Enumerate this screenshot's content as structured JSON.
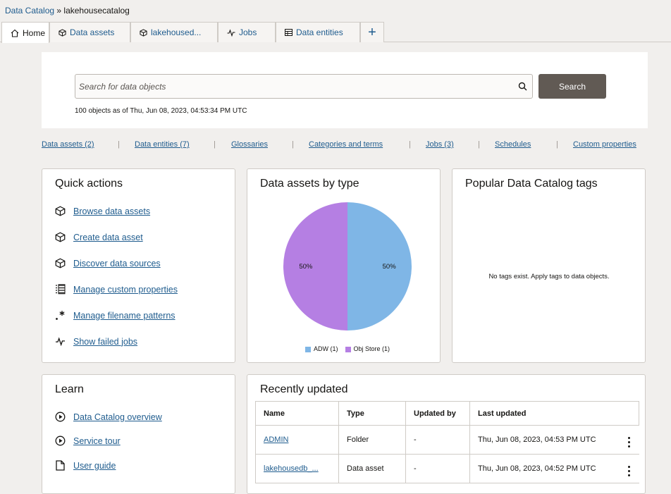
{
  "breadcrumb": {
    "root": "Data Catalog",
    "separator": "»",
    "current": "lakehousecatalog"
  },
  "tabs": [
    {
      "label": "Home",
      "icon": "home-icon"
    },
    {
      "label": "Data assets",
      "icon": "cube-icon"
    },
    {
      "label": "lakehoused...",
      "icon": "cube-icon"
    },
    {
      "label": "Jobs",
      "icon": "pulse-icon"
    },
    {
      "label": "Data entities",
      "icon": "table-icon"
    }
  ],
  "add_tab_label": "+",
  "search": {
    "placeholder": "Search for data objects",
    "button": "Search",
    "status": "100 objects as of Thu, Jun 08, 2023, 04:53:34 PM UTC"
  },
  "quicklinks": [
    "Data assets (2)",
    "Data entities (7)",
    "Glossaries",
    "Categories and terms",
    "Jobs (3)",
    "Schedules",
    "Custom properties"
  ],
  "quick_actions": {
    "title": "Quick actions",
    "items": [
      {
        "label": "Browse data assets",
        "icon": "cube-icon"
      },
      {
        "label": "Create data asset",
        "icon": "cube-icon"
      },
      {
        "label": "Discover data sources",
        "icon": "cube-icon"
      },
      {
        "label": "Manage custom properties",
        "icon": "list-icon"
      },
      {
        "label": "Manage filename patterns",
        "icon": "asterisk-icon"
      },
      {
        "label": "Show failed jobs",
        "icon": "pulse-icon"
      }
    ]
  },
  "assets_by_type": {
    "title": "Data assets by type",
    "colors": {
      "ADW": "#7fb6e6",
      "Obj Store": "#b57fe3"
    }
  },
  "chart_data": {
    "type": "pie",
    "title": "Data assets by type",
    "categories": [
      "ADW (1)",
      "Obj Store (1)"
    ],
    "values": [
      1,
      1
    ],
    "labels": [
      "50%",
      "50%"
    ],
    "legend": "bottom"
  },
  "tags": {
    "title": "Popular Data Catalog tags",
    "empty": "No tags exist. Apply tags to data objects."
  },
  "learn": {
    "title": "Learn",
    "items": [
      {
        "label": "Data Catalog overview",
        "icon": "play-circle-icon"
      },
      {
        "label": "Service tour",
        "icon": "play-circle-icon"
      },
      {
        "label": "User guide",
        "icon": "document-icon"
      }
    ]
  },
  "recent": {
    "title": "Recently updated",
    "columns": [
      "Name",
      "Type",
      "Updated by",
      "Last updated"
    ],
    "rows": [
      {
        "name": "ADMIN",
        "type": "Folder",
        "updated_by": "-",
        "last_updated": "Thu, Jun 08, 2023, 04:53 PM UTC"
      },
      {
        "name": "lakehousedb_...",
        "type": "Data asset",
        "updated_by": "-",
        "last_updated": "Thu, Jun 08, 2023, 04:52 PM UTC"
      }
    ]
  }
}
